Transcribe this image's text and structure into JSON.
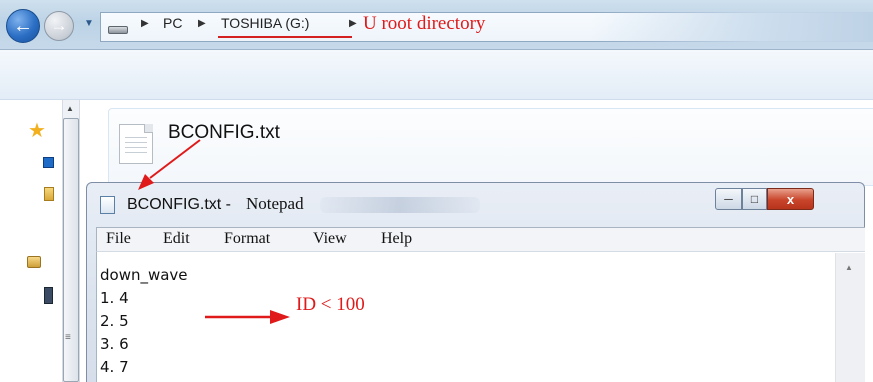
{
  "explorer": {
    "breadcrumb": [
      "PC",
      "TOSHIBA (G:)"
    ],
    "annotation_root": "U root directory",
    "file_name": "BCONFIG.txt"
  },
  "notepad": {
    "title_file": "BCONFIG.txt -",
    "title_app": "Notepad",
    "menu": [
      "File",
      "Edit",
      "Format",
      "View",
      "Help"
    ],
    "close_glyph": "x",
    "content_lines": [
      "down_wave",
      "1. 4",
      "2. 5",
      "3. 6",
      "4. 7"
    ]
  },
  "annotations": {
    "id_note": "ID < 100",
    "color": "#e01a1a"
  },
  "icons": {
    "back": "back-arrow-icon",
    "forward": "forward-arrow-icon",
    "drive": "drive-icon",
    "favorites": "star-icon",
    "file": "text-file-icon"
  }
}
